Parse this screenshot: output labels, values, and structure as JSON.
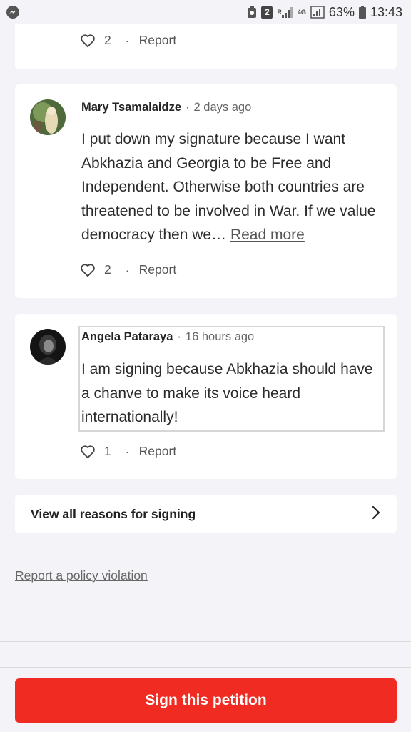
{
  "status_bar": {
    "app_icon": "messenger-icon",
    "badge": "2",
    "signal_r": "R",
    "network": "4G",
    "battery_percent": "63%",
    "time": "13:43"
  },
  "comments": [
    {
      "likes": "2",
      "report_label": "Report"
    },
    {
      "author": "Mary Tsamalaidze",
      "time_ago": "2 days ago",
      "text": "I put down my signature because I want Abkhazia and Georgia to be Free and Independent. Otherwise both countries are threatened to be involved in War. If we value democracy then we…",
      "read_more": "Read more",
      "likes": "2",
      "report_label": "Report"
    },
    {
      "author": "Angela Pataraya",
      "time_ago": "16 hours ago",
      "text": "I am signing because Abkhazia should have a chanve to make its voice heard internationally!",
      "likes": "1",
      "report_label": "Report"
    }
  ],
  "view_all_label": "View all reasons for signing",
  "policy_link": "Report a policy violation",
  "sign_button": "Sign this petition",
  "colors": {
    "accent": "#ef2b22",
    "background": "#f4f3f7",
    "card": "#ffffff"
  }
}
